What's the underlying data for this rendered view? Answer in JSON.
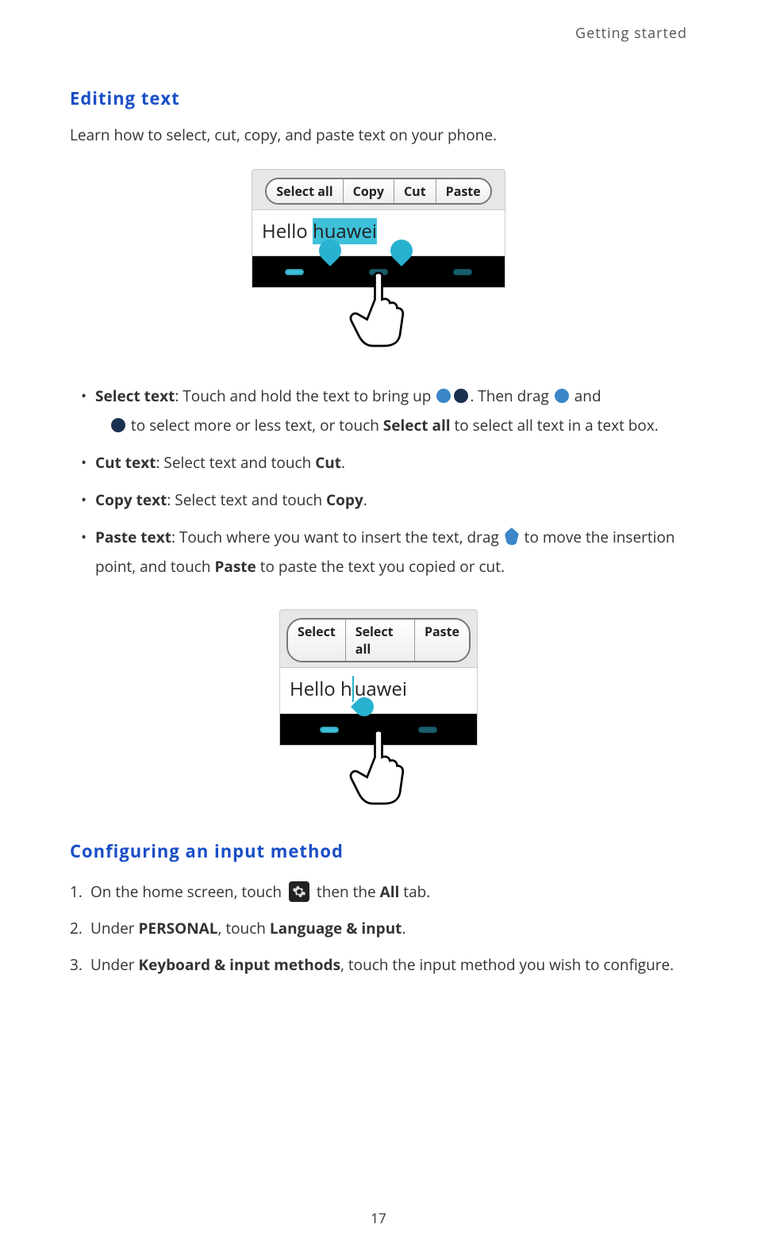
{
  "header": {
    "section": "Getting started"
  },
  "editing": {
    "heading": "Editing text",
    "intro": "Learn how to select, cut, copy, and paste text on your phone.",
    "fig1": {
      "buttons": [
        "Select all",
        "Copy",
        "Cut",
        "Paste"
      ],
      "text_plain": "Hello ",
      "text_selected": "huawei"
    },
    "bullets": {
      "select": {
        "label": "Select text",
        "part1": ": Touch and hold the text to bring up ",
        "part2": ". Then drag ",
        "part3": " and",
        "part4": " to select more or less text, or touch ",
        "select_all": "Select all",
        "part5": " to select all text in a text box."
      },
      "cut": {
        "label": "Cut text",
        "middle": ": Select text and touch ",
        "action": "Cut",
        "end": "."
      },
      "copy": {
        "label": "Copy text",
        "middle": ": Select text and touch ",
        "action": "Copy",
        "end": "."
      },
      "paste": {
        "label": "Paste text",
        "part1": ": Touch where you want to insert the text, drag ",
        "part2": " to move the insertion point, and touch ",
        "action": "Paste",
        "part3": " to paste the text you copied or cut."
      }
    },
    "fig2": {
      "buttons": [
        "Select",
        "Select all",
        "Paste"
      ],
      "text_before": "Hello h",
      "text_after": "uawei"
    }
  },
  "config": {
    "heading": "Configuring an input method",
    "steps": {
      "s1a": "On the home screen, touch ",
      "s1b": " then the ",
      "s1_all": "All",
      "s1c": " tab.",
      "s2a": "Under ",
      "s2_personal": "PERSONAL",
      "s2b": ", touch ",
      "s2_lang": "Language & input",
      "s2c": ".",
      "s3a": "Under ",
      "s3_kb": "Keyboard & input methods",
      "s3b": ", touch the input method you wish to configure."
    }
  },
  "page_number": "17"
}
